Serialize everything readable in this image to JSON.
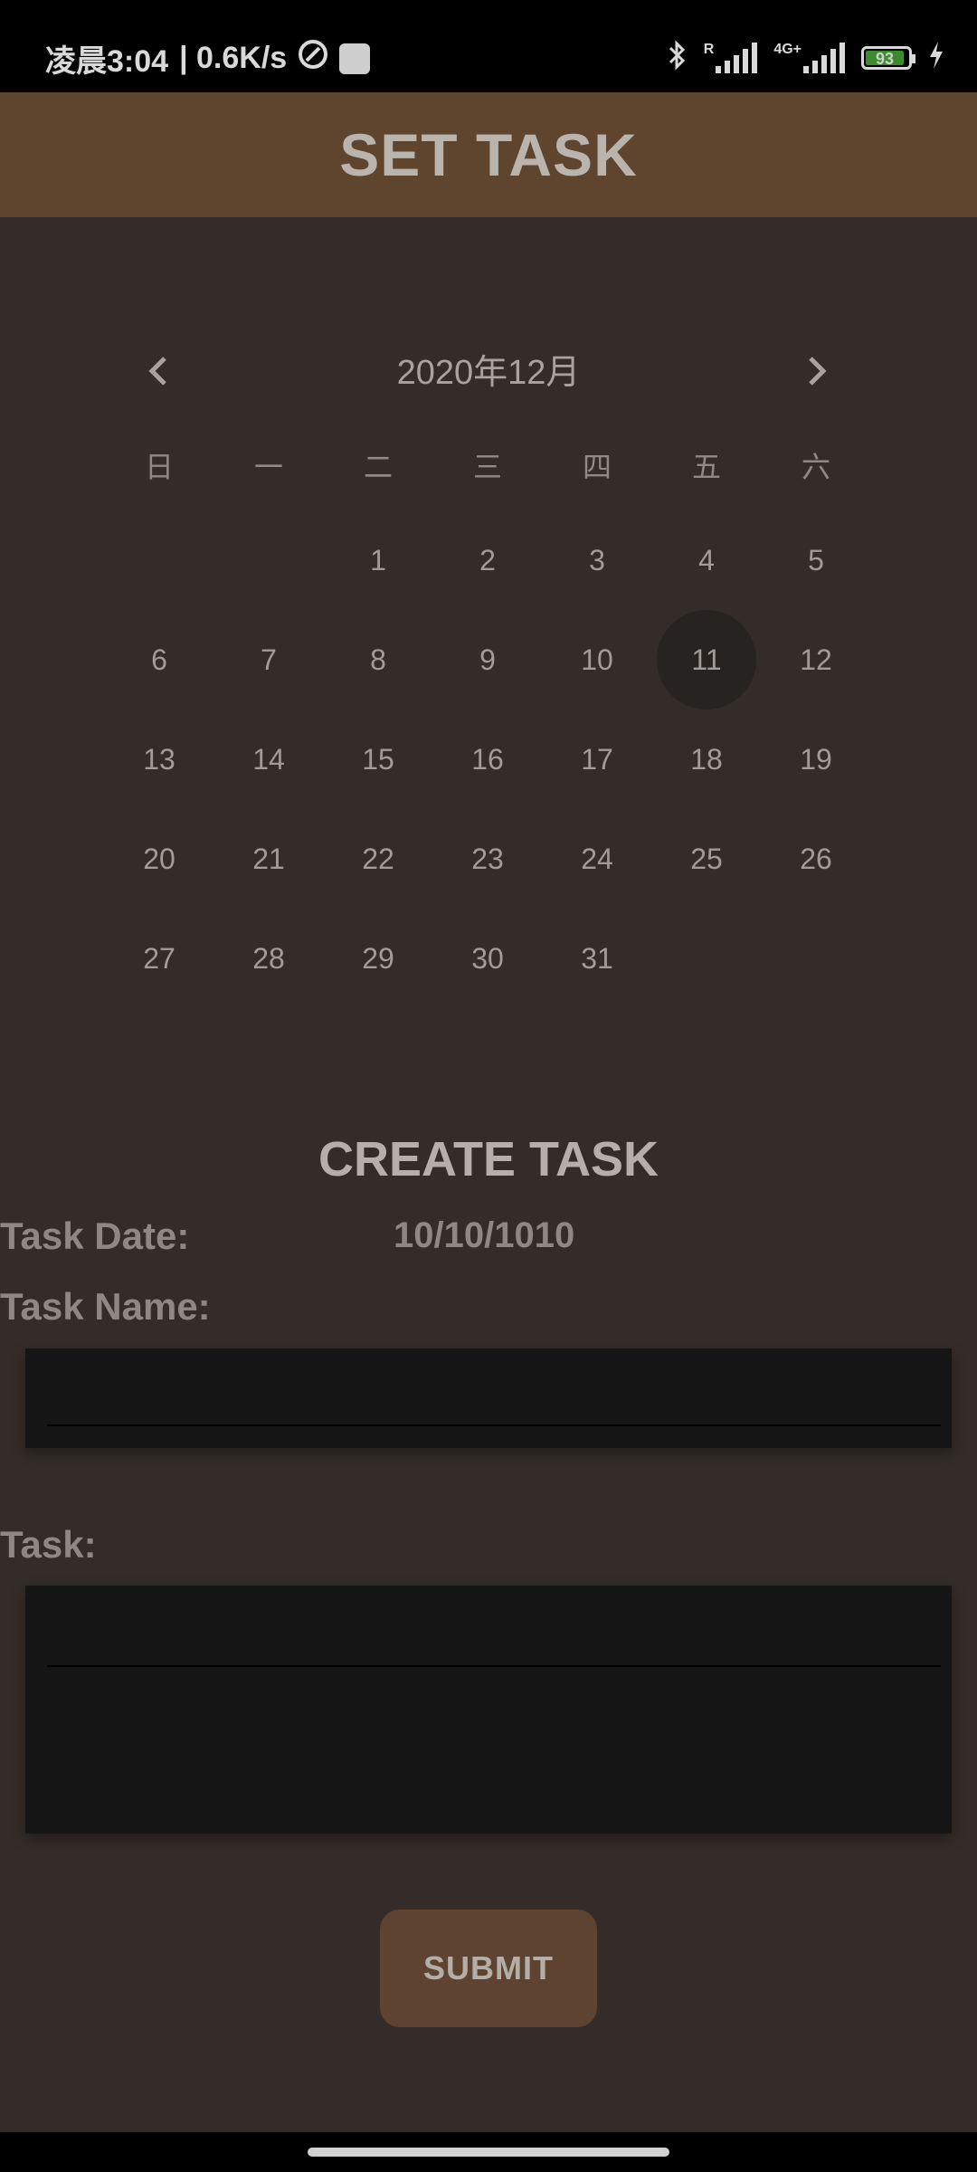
{
  "status_bar": {
    "time": "凌晨3:04",
    "network_speed": "| 0.6K/s",
    "battery": "93",
    "signal1_label": "R",
    "signal2_label": "4G+"
  },
  "app_bar": {
    "title": "SET TASK"
  },
  "calendar": {
    "month_label": "2020年12月",
    "weekdays": [
      "日",
      "一",
      "二",
      "三",
      "四",
      "五",
      "六"
    ],
    "weeks": [
      [
        "",
        "",
        "1",
        "2",
        "3",
        "4",
        "5"
      ],
      [
        "6",
        "7",
        "8",
        "9",
        "10",
        "11",
        "12"
      ],
      [
        "13",
        "14",
        "15",
        "16",
        "17",
        "18",
        "19"
      ],
      [
        "20",
        "21",
        "22",
        "23",
        "24",
        "25",
        "26"
      ],
      [
        "27",
        "28",
        "29",
        "30",
        "31",
        "",
        ""
      ]
    ],
    "selected_day": "11"
  },
  "create_task": {
    "title": "CREATE TASK",
    "date_label": "Task Date:",
    "date_value": "10/10/1010",
    "name_label": "Task Name:",
    "name_value": "",
    "task_label": "Task:",
    "task_value": "",
    "submit_label": "SUBMIT"
  }
}
